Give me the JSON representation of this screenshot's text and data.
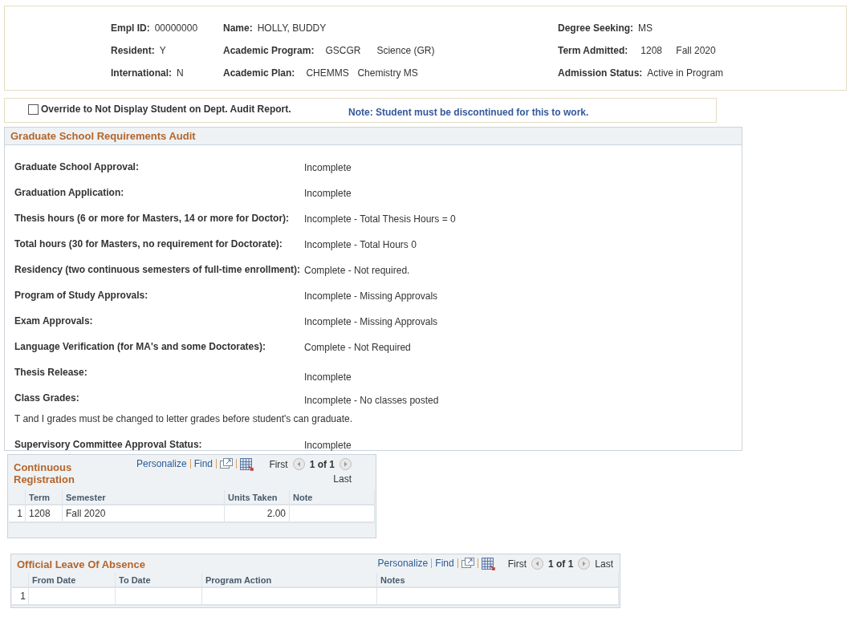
{
  "student": {
    "columns": [
      [
        {
          "label": "Empl ID:",
          "values": [
            "00000000"
          ]
        },
        {
          "label": "Resident:",
          "values": [
            "Y"
          ]
        },
        {
          "label": "International:",
          "values": [
            "N"
          ]
        }
      ],
      [
        {
          "label": "Name:",
          "values": [
            "HOLLY, BUDDY"
          ]
        },
        {
          "label": "Academic Program:",
          "values": [
            "GSCGR",
            "Science (GR)"
          ]
        },
        {
          "label": "Academic Plan:",
          "values": [
            "CHEMMS",
            "Chemistry MS"
          ]
        }
      ],
      [
        {
          "label": "Degree Seeking:",
          "values": [
            "MS"
          ]
        },
        {
          "label": "Term Admitted:",
          "values": [
            "1208",
            "Fall 2020"
          ]
        },
        {
          "label": "Admission Status:",
          "values": [
            "Active in Program"
          ]
        }
      ]
    ]
  },
  "override": {
    "label": "Override to Not Display Student on Dept. Audit Report.",
    "checked": false,
    "note": "Note: Student must be discontinued for this to work."
  },
  "audit": {
    "title": "Graduate School Requirements Audit",
    "items": [
      {
        "kind": "requirement",
        "label": "Graduate School Approval:",
        "value": "Incomplete"
      },
      {
        "kind": "requirement",
        "label": "Graduation Application:",
        "value": "Incomplete"
      },
      {
        "kind": "requirement",
        "label": "Thesis hours (6 or more for Masters, 14 or more for Doctor):",
        "value": "Incomplete - Total Thesis Hours = 0"
      },
      {
        "kind": "requirement",
        "label": "Total hours (30 for Masters, no requirement for Doctorate):",
        "value": "Incomplete - Total Hours 0"
      },
      {
        "kind": "requirement",
        "label": "Residency (two continuous semesters of full-time enrollment):",
        "value": "Complete - Not required."
      },
      {
        "kind": "requirement",
        "label": "Program of Study Approvals:",
        "value": "Incomplete - Missing Approvals"
      },
      {
        "kind": "requirement",
        "label": "Exam Approvals:",
        "value": "Incomplete - Missing Approvals"
      },
      {
        "kind": "requirement",
        "label": "Language Verification (for MA's and some Doctorates):",
        "value": "Complete - Not Required"
      },
      {
        "kind": "requirement",
        "label": "Thesis Release:",
        "value": "Incomplete"
      },
      {
        "kind": "requirement",
        "label": "Class Grades:",
        "value": "Incomplete - No classes posted"
      },
      {
        "kind": "note",
        "label": "T and I grades must be changed to letter grades before  student's can graduate."
      },
      {
        "kind": "requirement",
        "label": "Supervisory Committee Approval Status:",
        "value": "Incomplete"
      }
    ]
  },
  "grids": [
    {
      "title": "Continuous Registration",
      "personalize": "Personalize",
      "find": "Find",
      "first": "First",
      "count": "1 of 1",
      "last": "Last",
      "columns": [
        "Term",
        "Semester",
        "Units Taken",
        "Note"
      ],
      "rows": [
        {
          "number": "1",
          "cells": [
            "1208",
            "Fall 2020",
            "2.00",
            ""
          ]
        }
      ]
    },
    {
      "title": "Official Leave Of Absence",
      "personalize": "Personalize",
      "find": "Find",
      "first": "First",
      "count": "1 of 1",
      "last": "Last",
      "columns": [
        "From Date",
        "To Date",
        "Program Action",
        "Notes"
      ],
      "rows": [
        {
          "number": "1",
          "cells": [
            "",
            "",
            "",
            ""
          ]
        }
      ]
    }
  ]
}
